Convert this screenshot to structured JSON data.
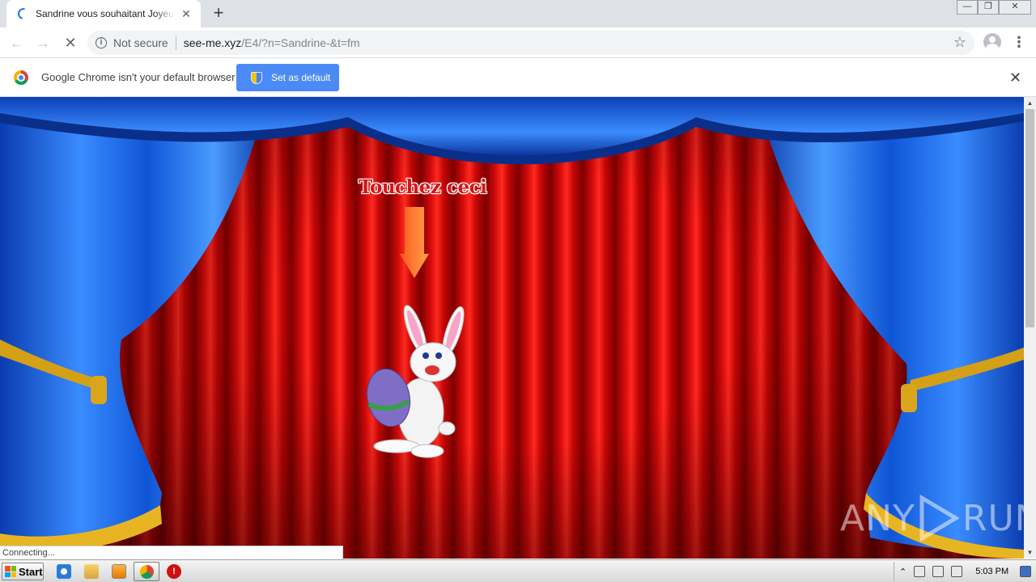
{
  "browser": {
    "tab_title": "Sandrine vous souhaitant Joyeuses P",
    "tab_close": "✕",
    "new_tab": "+",
    "window_controls": {
      "minimize": "—",
      "restore": "❐",
      "close": "✕"
    }
  },
  "toolbar": {
    "back": "←",
    "forward": "→",
    "stop": "✕",
    "security_label": "Not secure",
    "url_host": "see-me.xyz",
    "url_path": "/E4/?n=Sandrine-&t=fm",
    "bookmark": "☆",
    "menu": "⋮"
  },
  "infobar": {
    "message": "Google Chrome isn't your default browser",
    "button_label": "Set as default",
    "close": "✕"
  },
  "page": {
    "call_to_action": "Touchez ceci",
    "watermark_left": "ANY",
    "watermark_right": "RUN",
    "status_text": "Connecting..."
  },
  "taskbar": {
    "start_label": "Start",
    "clock": "5:03 PM",
    "tray_expand": "⌃"
  },
  "colors": {
    "curtain_red": "#d40a0a",
    "curtain_blue": "#1565d8",
    "accent_blue": "#4c8bf5",
    "cta_text": "#d61515"
  },
  "icons": [
    "info-icon",
    "star-icon",
    "avatar-icon",
    "chrome-logo-icon",
    "shield-icon",
    "arrow-down-icon",
    "bunny-image",
    "windows-flag-icon",
    "ie-icon",
    "explorer-icon",
    "media-player-icon",
    "chrome-icon",
    "alert-icon"
  ]
}
